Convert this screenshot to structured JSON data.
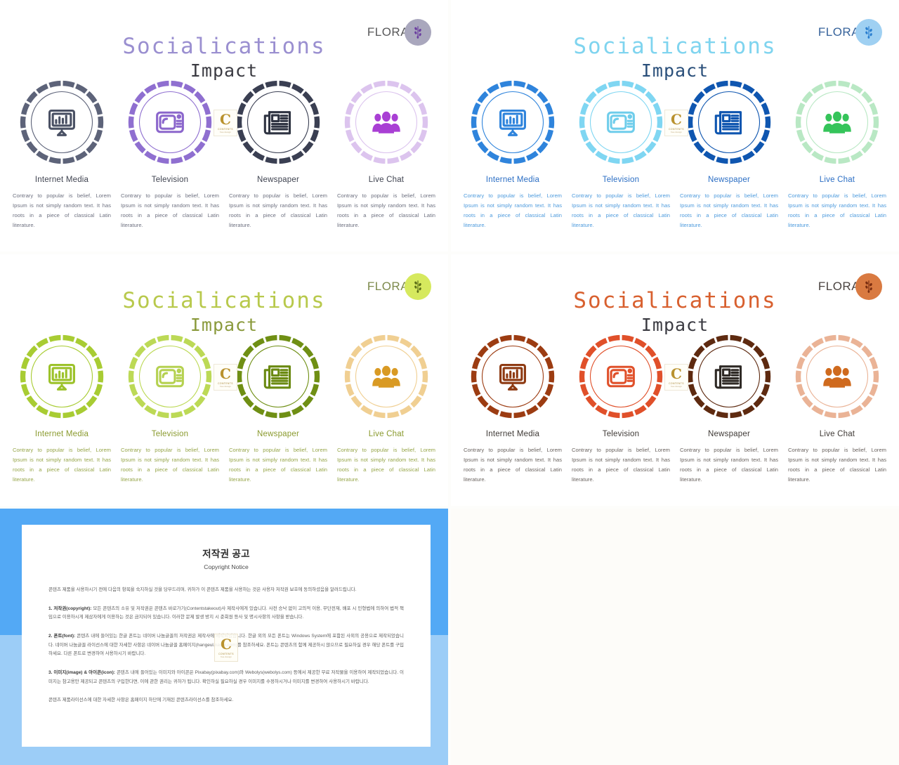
{
  "meta": {
    "brand_name": "FLORAL",
    "watermark_letter": "C",
    "watermark_line1": "CONTENTS",
    "watermark_line2": "free design"
  },
  "headings": {
    "title": "Socialications",
    "subtitle": "Impact"
  },
  "cards": [
    {
      "id": "internet-media",
      "title": "Internet Media",
      "icon": "monitor-chart-icon",
      "body": "Contrary to popular is belief, Lorem Ipsum is not simply random text. It has roots in a piece of classical Latin literature."
    },
    {
      "id": "television",
      "title": "Television",
      "icon": "television-icon",
      "body": "Contrary to popular is belief, Lorem Ipsum is not simply random text. It has roots in a piece of classical Latin literature."
    },
    {
      "id": "newspaper",
      "title": "Newspaper",
      "icon": "newspaper-icon",
      "body": "Contrary to popular is belief, Lorem Ipsum is not simply random text. It has roots in a piece of classical Latin literature."
    },
    {
      "id": "live-chat",
      "title": "Live Chat",
      "icon": "people-group-icon",
      "body": "Contrary to popular is belief, Lorem Ipsum is not simply random text. It has roots in a piece of classical Latin literature."
    }
  ],
  "themes": [
    {
      "key": "purple",
      "name": "purple-theme-slide",
      "title_color": "#9a8fd0",
      "subtitle_color": "#3b3b42",
      "card_title_color": "#3f4350",
      "body_color": "#6e7180",
      "logo_text_color": "#58585a",
      "logo_badge_color": "#a9a7bd",
      "logo_badge_icon_color": "#6b3fa0",
      "ring_colors": [
        "#5d6379",
        "#8f6fd0",
        "#3a3f52",
        "#dcc4ee"
      ],
      "icon_colors": [
        "#4a5164",
        "#8b66cc",
        "#2f3442",
        "#a93fd4"
      ]
    },
    {
      "key": "blue",
      "name": "blue-theme-slide",
      "title_color": "#7fd4ef",
      "subtitle_color": "#2a4f7a",
      "card_title_color": "#2b6ec4",
      "body_color": "#4e9bdd",
      "logo_text_color": "#37639b",
      "logo_badge_color": "#9fd0f2",
      "logo_badge_icon_color": "#2a7fd0",
      "ring_colors": [
        "#2f84dc",
        "#7fd6f2",
        "#0f56b0",
        "#b9e8c4"
      ],
      "icon_colors": [
        "#2f84dc",
        "#6fcdeb",
        "#0f56b0",
        "#35c45a"
      ]
    },
    {
      "key": "green",
      "name": "green-theme-slide",
      "title_color": "#b8c94c",
      "subtitle_color": "#8a9a3c",
      "card_title_color": "#8a9a2e",
      "body_color": "#97a64a",
      "logo_text_color": "#7d8a4c",
      "logo_badge_color": "#d6e95e",
      "logo_badge_icon_color": "#5e7018",
      "ring_colors": [
        "#a8cc33",
        "#bcd956",
        "#6f8f14",
        "#f0cf92"
      ],
      "icon_colors": [
        "#9cc22a",
        "#b5d150",
        "#6b8a12",
        "#d99a24"
      ]
    },
    {
      "key": "orange",
      "name": "orange-theme-slide",
      "title_color": "#d8602f",
      "subtitle_color": "#3b3b42",
      "card_title_color": "#3f3a36",
      "body_color": "#6b6460",
      "logo_text_color": "#4a4340",
      "logo_badge_color": "#d97a41",
      "logo_badge_icon_color": "#7a2d10",
      "ring_colors": [
        "#9c3c12",
        "#e0502a",
        "#5e2a10",
        "#eab396"
      ],
      "icon_colors": [
        "#8e3a12",
        "#e0502a",
        "#2f2a26",
        "#cf6a1e"
      ]
    }
  ],
  "copyright": {
    "name": "copyright-notice-slide",
    "title": "저작권 공고",
    "subtitle": "Copyright Notice",
    "intro": "콘텐츠 제품을 사용하시기 전에 다음의 항목을 숙지하실 것을 당부드리며, 귀하가 이 콘텐츠 제품을 사용하는 것은 사용자 저작권 보호에 동의하셨음을 알려드립니다.",
    "sections": [
      {
        "heading": "1. 저작권(copyright):",
        "text": "모든 콘텐츠의 소유 및 저작권은 콘텐츠 바로가기(Contentstakeout)사 제작사에게 있습니다. 사전 승낙 없이 고의적 이용, 무단전재, 배포 시 민형법에 의하여 법적 책임으로 이용하시게 제삼자에게 이용하는 것은 금지되어 있습니다. 이러한 문제 발생 방지 시 준회원 등사 및 명시사항의 사항을 받습니다."
      },
      {
        "heading": "2. 폰트(font):",
        "text": "콘텐츠 내에 들어있는 한글 폰트는 네이버 나눔글꼴의 저작권은 제작사에 제작되었습니다. 한글 외의 모든 폰트는 Windows System에 포함된 사외의 공용으로 제작되었습니다. 네이버 나눔글꼴 라이선스에 대한 자세한 사항은 네이버 나눔글꼴 홈페이지(hangeul.naver.com)를 참조하세요. 폰트는 콘텐츠의 함께 제공하시 않으므로 필요하실 경우 해당 폰트를 구입하세요. 다른 폰트로 변경하여 사용하시기 바랍니다."
      },
      {
        "heading": "3. 이미지(image) & 아이콘(icon):",
        "text": "콘텐츠 내에 들어있는 이미지와 아이콘은 Pixabay(pixabay.com)와 Webolys(webolys.com) 등에서 제공한 무료 저작물을 이용하여 제작되었습니다. 이미지는 참고용만 제공되고 콘텐츠의 구입한다면, 이에 관한 권리는 귀하가 됩니다. 확인하실 필요하실 경우 이미지를 수정하시거나 이미지를 변경하여 사용하시기 바랍니다."
      }
    ],
    "footer": "콘텐츠 제품라이선스에 대한 자세한 사항은 홈페이지 하단에 기재된 콘텐츠라이선스를 참조하세요."
  }
}
